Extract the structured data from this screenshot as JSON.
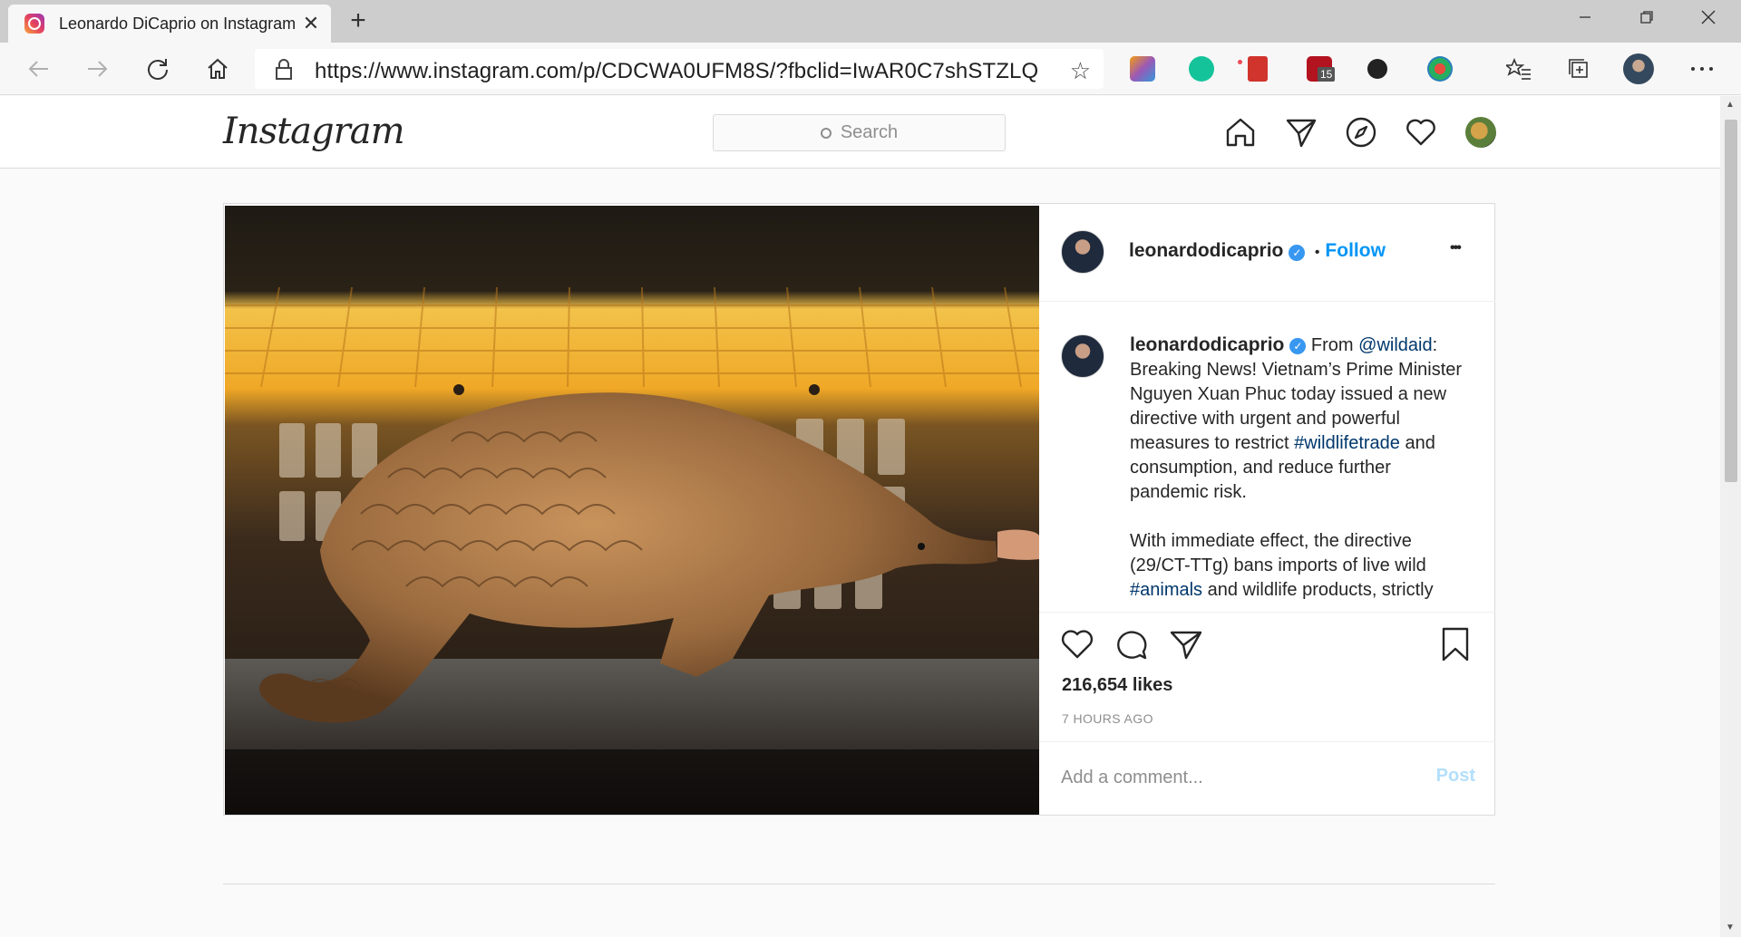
{
  "browser": {
    "tab_title": "Leonardo DiCaprio on Instagram",
    "url": "https://www.instagram.com/p/CDCWA0UFM8S/?fbclid=IwAR0C7shSTZLQ...",
    "extension_badge": "15"
  },
  "header": {
    "logo": "Instagram",
    "search_placeholder": "Search"
  },
  "post": {
    "username": "leonardodicaprio",
    "follow_separator": "•",
    "follow_label": "Follow",
    "more_label": "•••",
    "caption": {
      "username": "leonardodicaprio",
      "p1_a": "From ",
      "mention": "@wildaid",
      "p1_b": ": Breaking News! Vietnam’s Prime Minister Nguyen Xuan Phuc today issued a new directive with urgent and powerful measures to restrict ",
      "hashtag1": "#wildlifetrade",
      "p1_c": " and consumption, and reduce further pandemic risk.",
      "p2_a": "With immediate effect, the directive (29/CT-TTg) bans imports of live wild ",
      "hashtag2": "#animals",
      "p2_b": " and wildlife products, strictly"
    },
    "likes": "216,654 likes",
    "time": "7 HOURS AGO",
    "comment_placeholder": "Add a comment...",
    "post_label": "Post"
  },
  "colors": {
    "link_blue": "#0095f6",
    "hashtag": "#00376b",
    "notification_dot": "#ed4956"
  }
}
